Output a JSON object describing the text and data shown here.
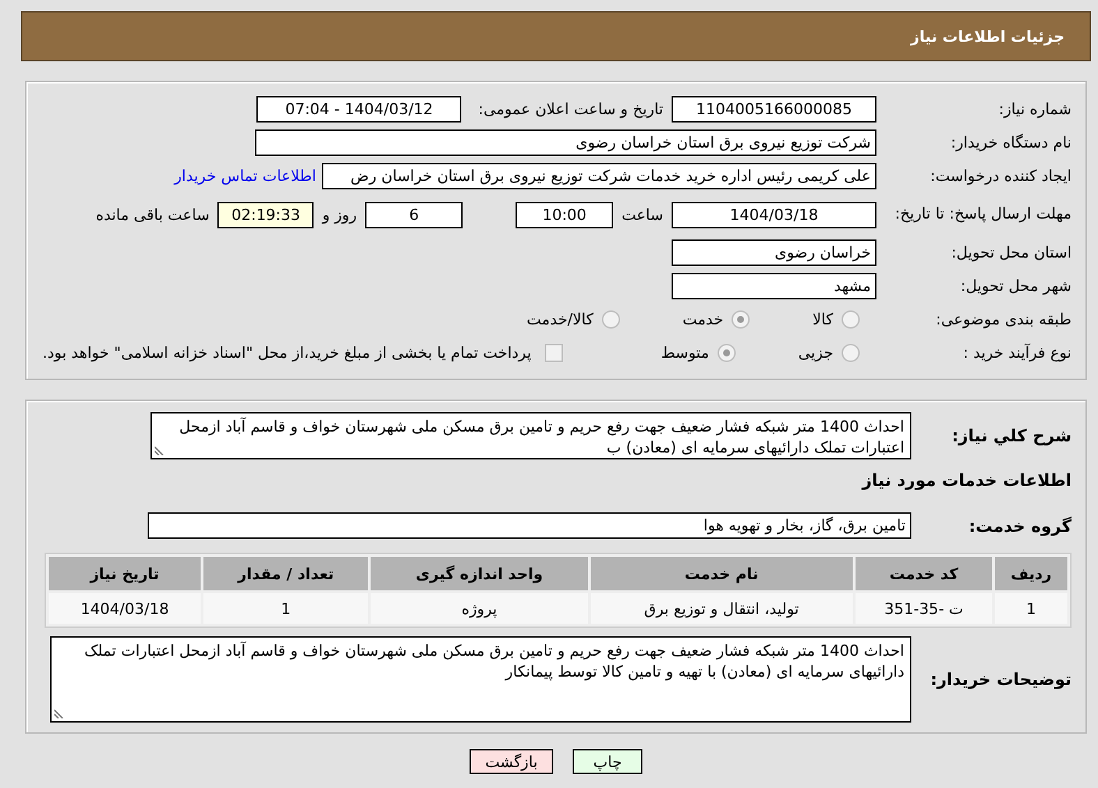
{
  "header": {
    "title": "جزئیات اطلاعات نیاز"
  },
  "need_number": {
    "label": "شماره نیاز:",
    "value": "1104005166000085"
  },
  "announce": {
    "label": "تاریخ و ساعت اعلان عمومی:",
    "value": "1404/03/12 - 07:04"
  },
  "buyer_org": {
    "label": "نام دستگاه خریدار:",
    "value": "شرکت توزیع نیروی برق استان خراسان رضوی"
  },
  "requester": {
    "label": "ایجاد کننده درخواست:",
    "value": "علی کریمی رئیس اداره خرید خدمات شرکت توزیع نیروی برق استان خراسان رض",
    "link": "اطلاعات تماس خریدار"
  },
  "deadline": {
    "label": "مهلت ارسال پاسخ: تا تاریخ:",
    "date": "1404/03/18",
    "time_label": "ساعت",
    "time": "10:00",
    "days": "6",
    "days_label": "روز و",
    "remaining": "02:19:33",
    "remaining_label": "ساعت باقی مانده"
  },
  "province": {
    "label": "استان محل تحویل:",
    "value": "خراسان رضوی"
  },
  "city": {
    "label": "شهر محل تحویل:",
    "value": "مشهد"
  },
  "category": {
    "label": "طبقه بندی موضوعی:",
    "options": [
      {
        "label": "کالا",
        "selected": false
      },
      {
        "label": "خدمت",
        "selected": true
      },
      {
        "label": "کالا/خدمت",
        "selected": false
      }
    ]
  },
  "process": {
    "label": "نوع فرآیند خرید :",
    "options": [
      {
        "label": "جزیی",
        "selected": false
      },
      {
        "label": "متوسط",
        "selected": true
      }
    ],
    "payment": {
      "checked": false,
      "label": "پرداخت تمام یا بخشی از مبلغ خرید،از محل \"اسناد خزانه اسلامی\" خواهد بود."
    }
  },
  "description": {
    "label": "شرح کلي نياز:",
    "value": "احداث  1400 متر شبکه فشار ضعیف جهت رفع حریم و تامین برق  مسکن ملی شهرستان خواف و قاسم آباد ازمحل اعتبارات تملک دارائیهای سرمایه ای (معادن) ب"
  },
  "services_title": "اطلاعات خدمات مورد نیاز",
  "service_group": {
    "label": "گروه خدمت:",
    "value": "تامین برق، گاز، بخار و تهویه هوا"
  },
  "table": {
    "columns": [
      "ردیف",
      "کد خدمت",
      "نام خدمت",
      "واحد اندازه گیری",
      "تعداد / مقدار",
      "تاریخ نیاز"
    ],
    "rows": [
      [
        "1",
        "ت -35-351",
        "تولید، انتقال و توزیع برق",
        "پروژه",
        "1",
        "1404/03/18"
      ]
    ]
  },
  "buyer_notes": {
    "label": "توضیحات خریدار:",
    "value": "احداث  1400 متر شبکه فشار ضعیف جهت رفع حریم و تامین برق  مسکن ملی شهرستان خواف و قاسم آباد ازمحل اعتبارات تملک دارائیهای سرمایه ای (معادن) با تهیه و تامین کالا توسط پیمانکار"
  },
  "buttons": [
    {
      "label": "چاپ",
      "kind": "print"
    },
    {
      "label": "بازگشت",
      "kind": "back"
    }
  ]
}
